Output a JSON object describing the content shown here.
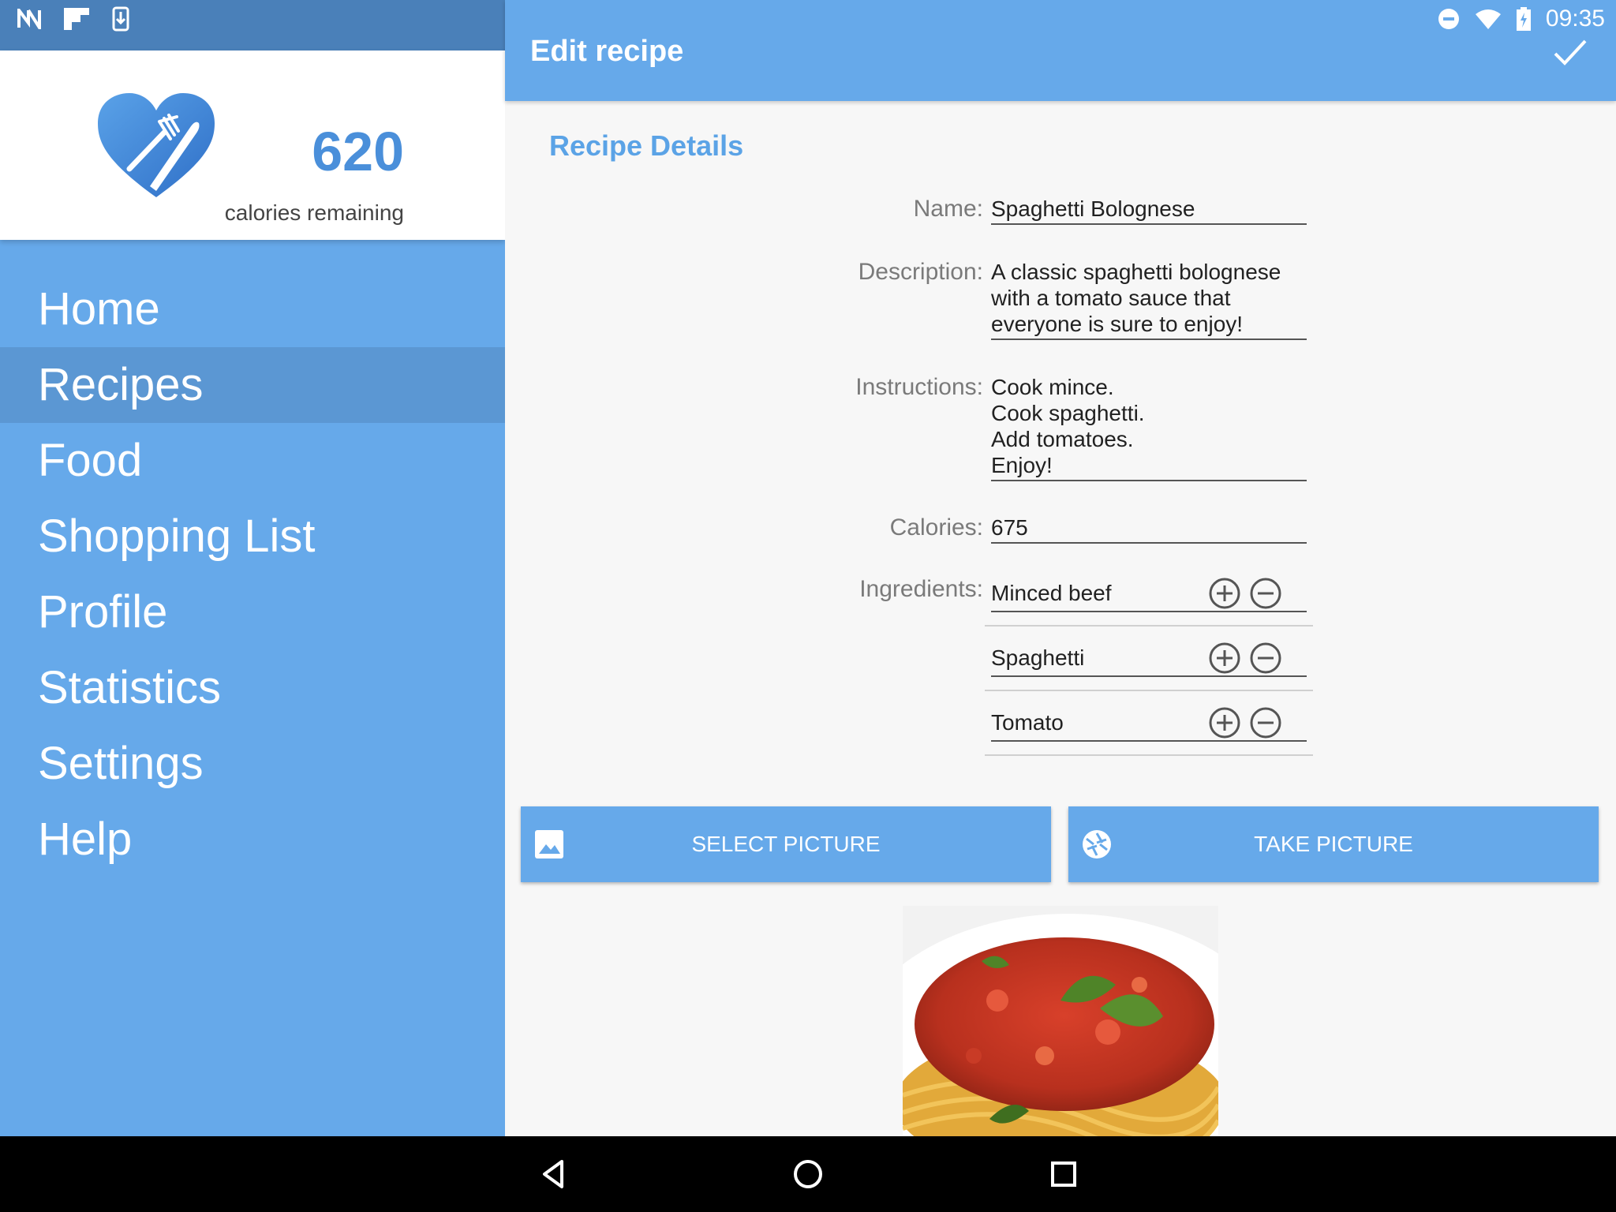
{
  "status_bar": {
    "time": "09:35",
    "left_icons": [
      "n-logo-icon",
      "flipboard-icon",
      "download-icon"
    ],
    "right_icons": [
      "do-not-disturb-icon",
      "wifi-icon",
      "battery-charging-icon"
    ]
  },
  "drawer": {
    "calories_remaining_value": "620",
    "calories_remaining_label": "calories remaining",
    "logo_icon": "heart-fork-knife-icon",
    "items": [
      {
        "label": "Home"
      },
      {
        "label": "Recipes"
      },
      {
        "label": "Food"
      },
      {
        "label": "Shopping List"
      },
      {
        "label": "Profile"
      },
      {
        "label": "Statistics"
      },
      {
        "label": "Settings"
      },
      {
        "label": "Help"
      }
    ],
    "active_item": "Recipes"
  },
  "appbar": {
    "title": "Edit recipe",
    "confirm_icon": "check-icon"
  },
  "form": {
    "section_title": "Recipe Details",
    "name_label": "Name:",
    "name_value": "Spaghetti Bolognese",
    "description_label": "Description:",
    "description_lines": [
      "A classic spaghetti bolognese",
      "with a tomato sauce that",
      "everyone is sure to enjoy!"
    ],
    "instructions_label": "Instructions:",
    "instructions_lines": [
      "Cook mince.",
      "Cook spaghetti.",
      "Add tomatoes.",
      "Enjoy!"
    ],
    "calories_label": "Calories:",
    "calories_value": "675",
    "ingredients_label": "Ingredients:",
    "ingredients": [
      "Minced beef",
      "Spaghetti",
      "Tomato"
    ]
  },
  "actions": {
    "select_picture": "SELECT PICTURE",
    "take_picture": "TAKE PICTURE"
  },
  "photo": {
    "alt": "spaghetti-bolognese-photo"
  },
  "colors": {
    "primary": "#66a9ea",
    "primary_dark": "#4a80b9",
    "accent_text": "#5ba3e6",
    "active_nav": "#5b97d3"
  }
}
